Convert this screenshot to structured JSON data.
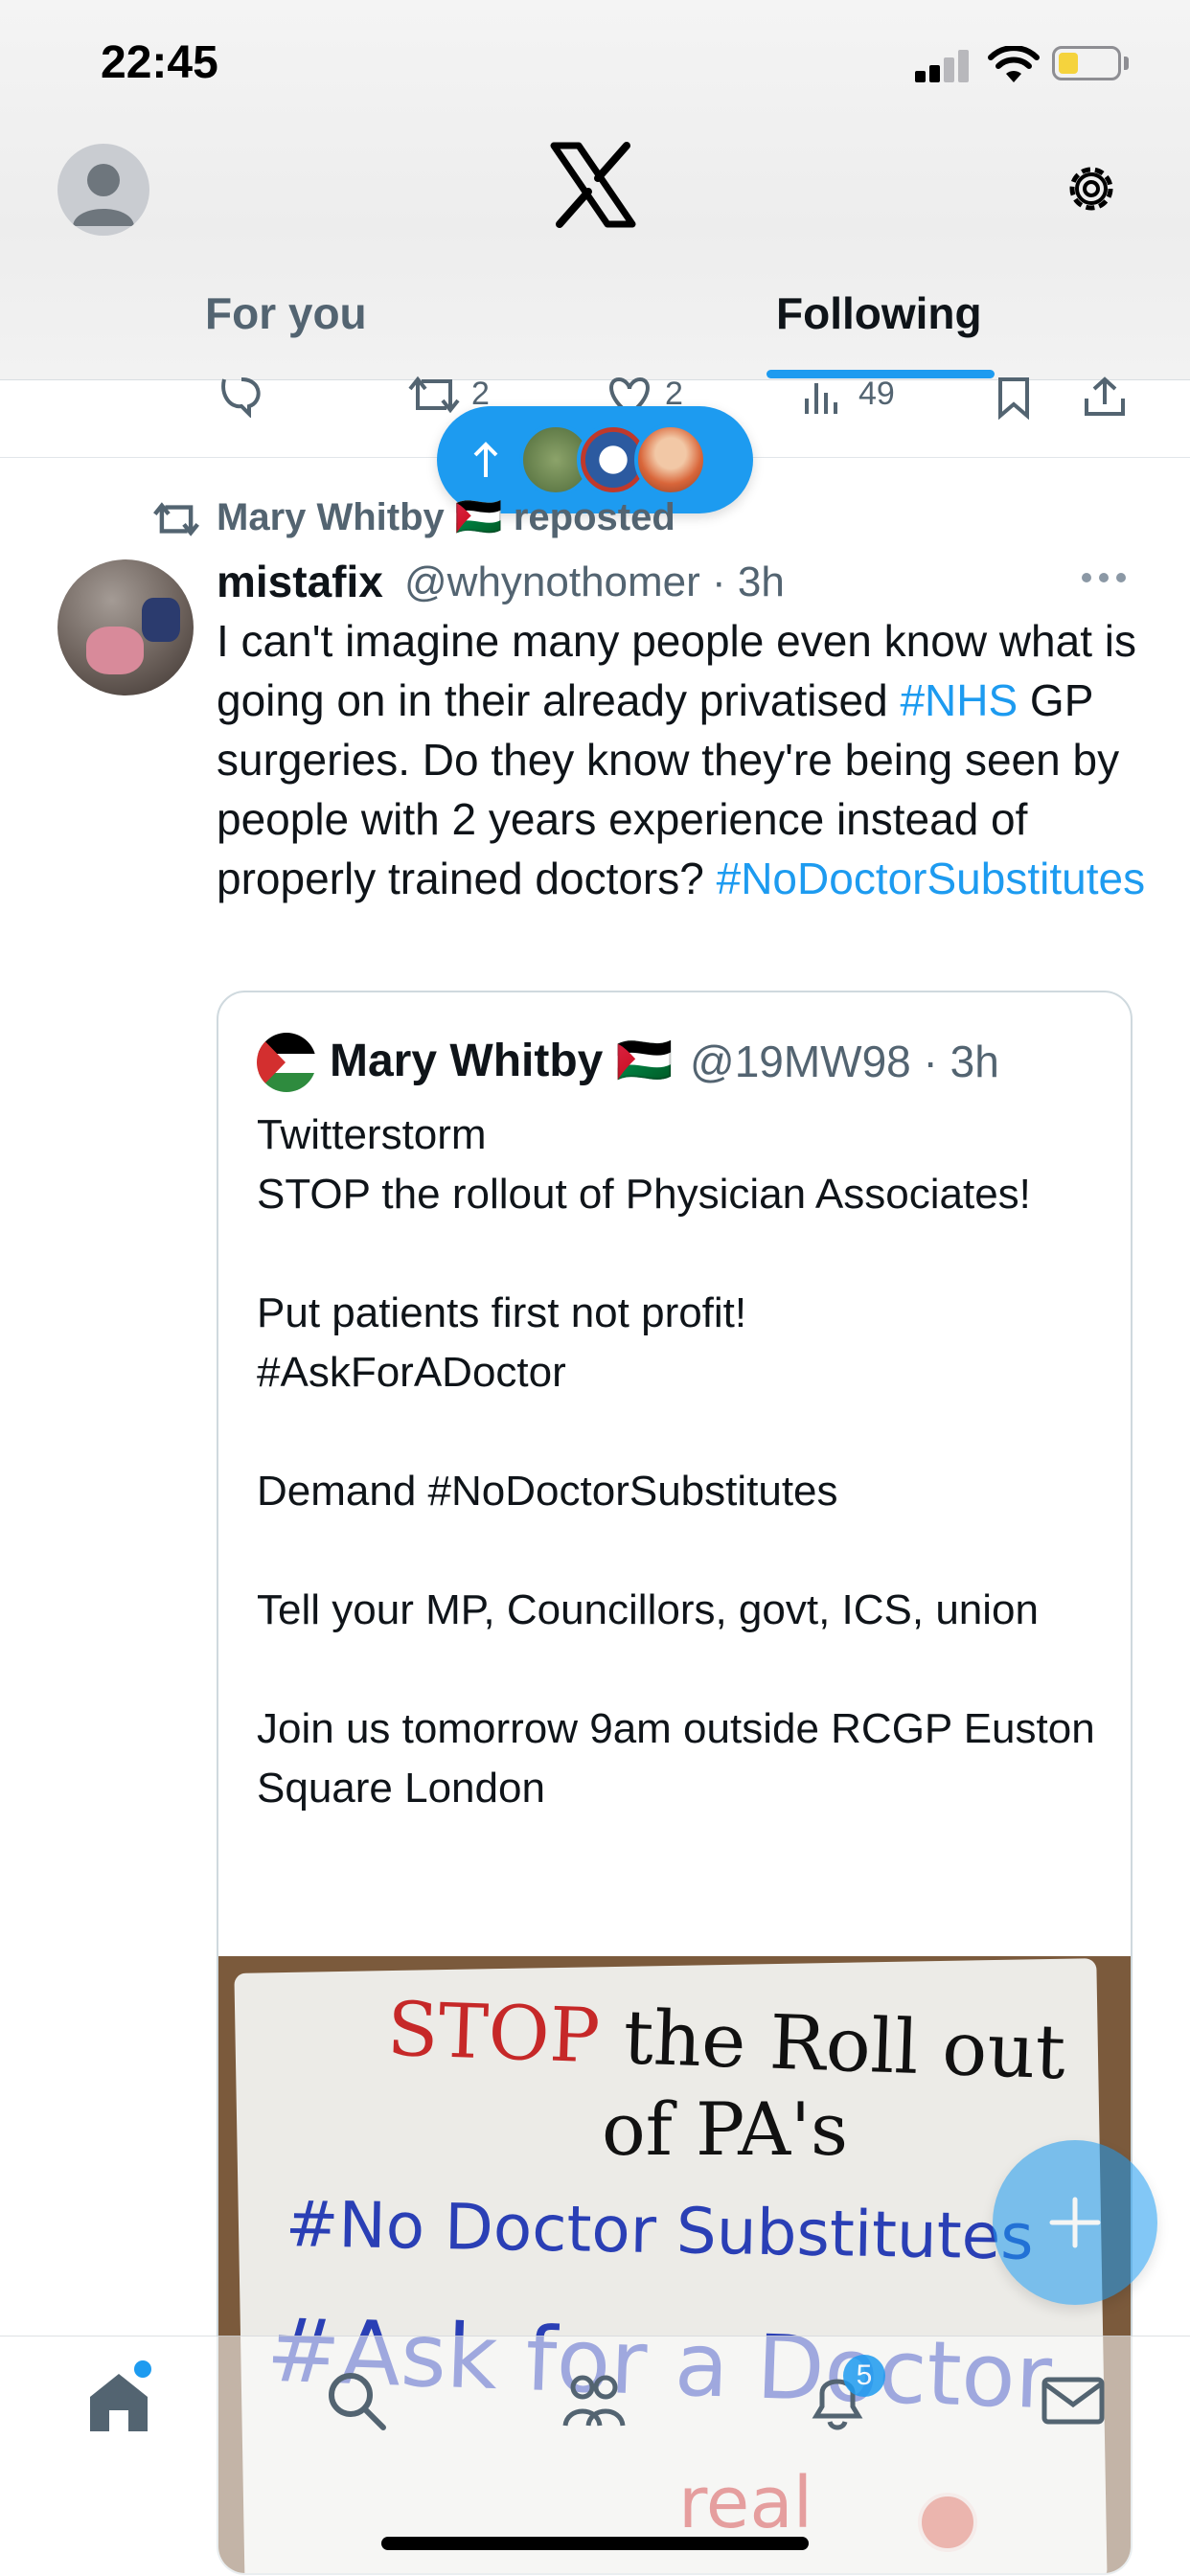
{
  "status_bar": {
    "time": "22:45"
  },
  "header": {
    "tabs": [
      {
        "label": "For you",
        "active": false
      },
      {
        "label": "Following",
        "active": true
      }
    ]
  },
  "prev_tweet_actions": {
    "retweets": "2",
    "likes": "2",
    "views": "49"
  },
  "tweet": {
    "repost_by": "Mary Whitby 🇵🇸 reposted",
    "author_name": "mistafix",
    "author_handle_time": "@whynothomer · 3h",
    "body_part1": "I can't imagine many people even know what is going on in their already privatised ",
    "body_tag1": "#NHS",
    "body_part2": " GP surgeries. Do they know they're being seen by people with 2 years experience instead of properly trained doctors? ",
    "body_tag2": "#NoDoctorSubstitutes",
    "quote": {
      "name": "Mary Whitby 🇵🇸",
      "handle_time": "@19MW98 · 3h",
      "text": "Twitterstorm\nSTOP the rollout of Physician Associates!\n\nPut patients first not profit!\n#AskForADoctor\n\nDemand #NoDoctorSubstitutes\n\nTell your MP, Councillors, govt, ICS, union\n\nJoin us tomorrow 9am outside RCGP Euston Square London",
      "image_text": {
        "line1a": "STOP",
        "line1b": " the Roll out",
        "line2": "of PA's",
        "line3": "#No Doctor Substitutes",
        "line4": "#Ask for a Doctor",
        "line5": "real"
      }
    }
  },
  "bottom_nav": {
    "notifications_badge": "5"
  },
  "colors": {
    "accent": "#1d9bf0",
    "text": "#0f1419",
    "muted": "#536471"
  }
}
